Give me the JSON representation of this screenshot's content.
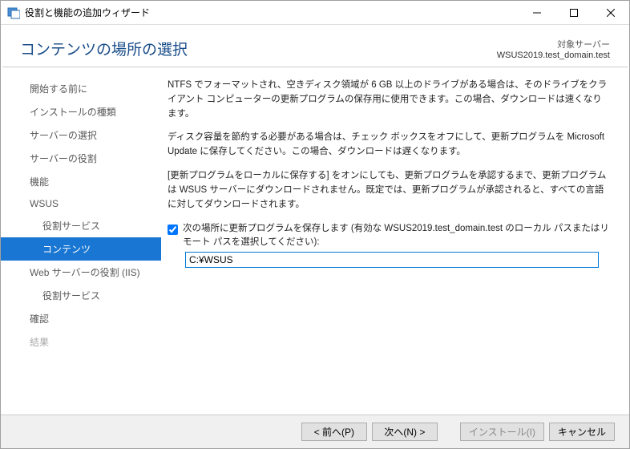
{
  "window": {
    "title": "役割と機能の追加ウィザード"
  },
  "header": {
    "title": "コンテンツの場所の選択",
    "server_label": "対象サーバー",
    "server_name": "WSUS2019.test_domain.test"
  },
  "sidebar": {
    "items": [
      {
        "label": "開始する前に"
      },
      {
        "label": "インストールの種類"
      },
      {
        "label": "サーバーの選択"
      },
      {
        "label": "サーバーの役割"
      },
      {
        "label": "機能"
      },
      {
        "label": "WSUS"
      },
      {
        "label": "役割サービス"
      },
      {
        "label": "コンテンツ"
      },
      {
        "label": "Web サーバーの役割 (IIS)"
      },
      {
        "label": "役割サービス"
      },
      {
        "label": "確認"
      },
      {
        "label": "結果"
      }
    ]
  },
  "main": {
    "p1": "NTFS でフォーマットされ、空きディスク領域が 6 GB 以上のドライブがある場合は、そのドライブをクライアント コンピューターの更新プログラムの保存用に使用できます。この場合、ダウンロードは速くなります。",
    "p2": "ディスク容量を節約する必要がある場合は、チェック ボックスをオフにして、更新プログラムを Microsoft Update に保存してください。この場合、ダウンロードは遅くなります。",
    "p3": "[更新プログラムをローカルに保存する] をオンにしても、更新プログラムを承認するまで、更新プログラムは WSUS サーバーにダウンロードされません。既定では、更新プログラムが承認されると、すべての言語に対してダウンロードされます。",
    "checkbox_label": "次の場所に更新プログラムを保存します (有効な WSUS2019.test_domain.test のローカル パスまたはリモート パスを選択してください):",
    "path_value": "C:¥WSUS"
  },
  "footer": {
    "prev": "< 前へ(P)",
    "next": "次へ(N) >",
    "install": "インストール(I)",
    "cancel": "キャンセル"
  }
}
